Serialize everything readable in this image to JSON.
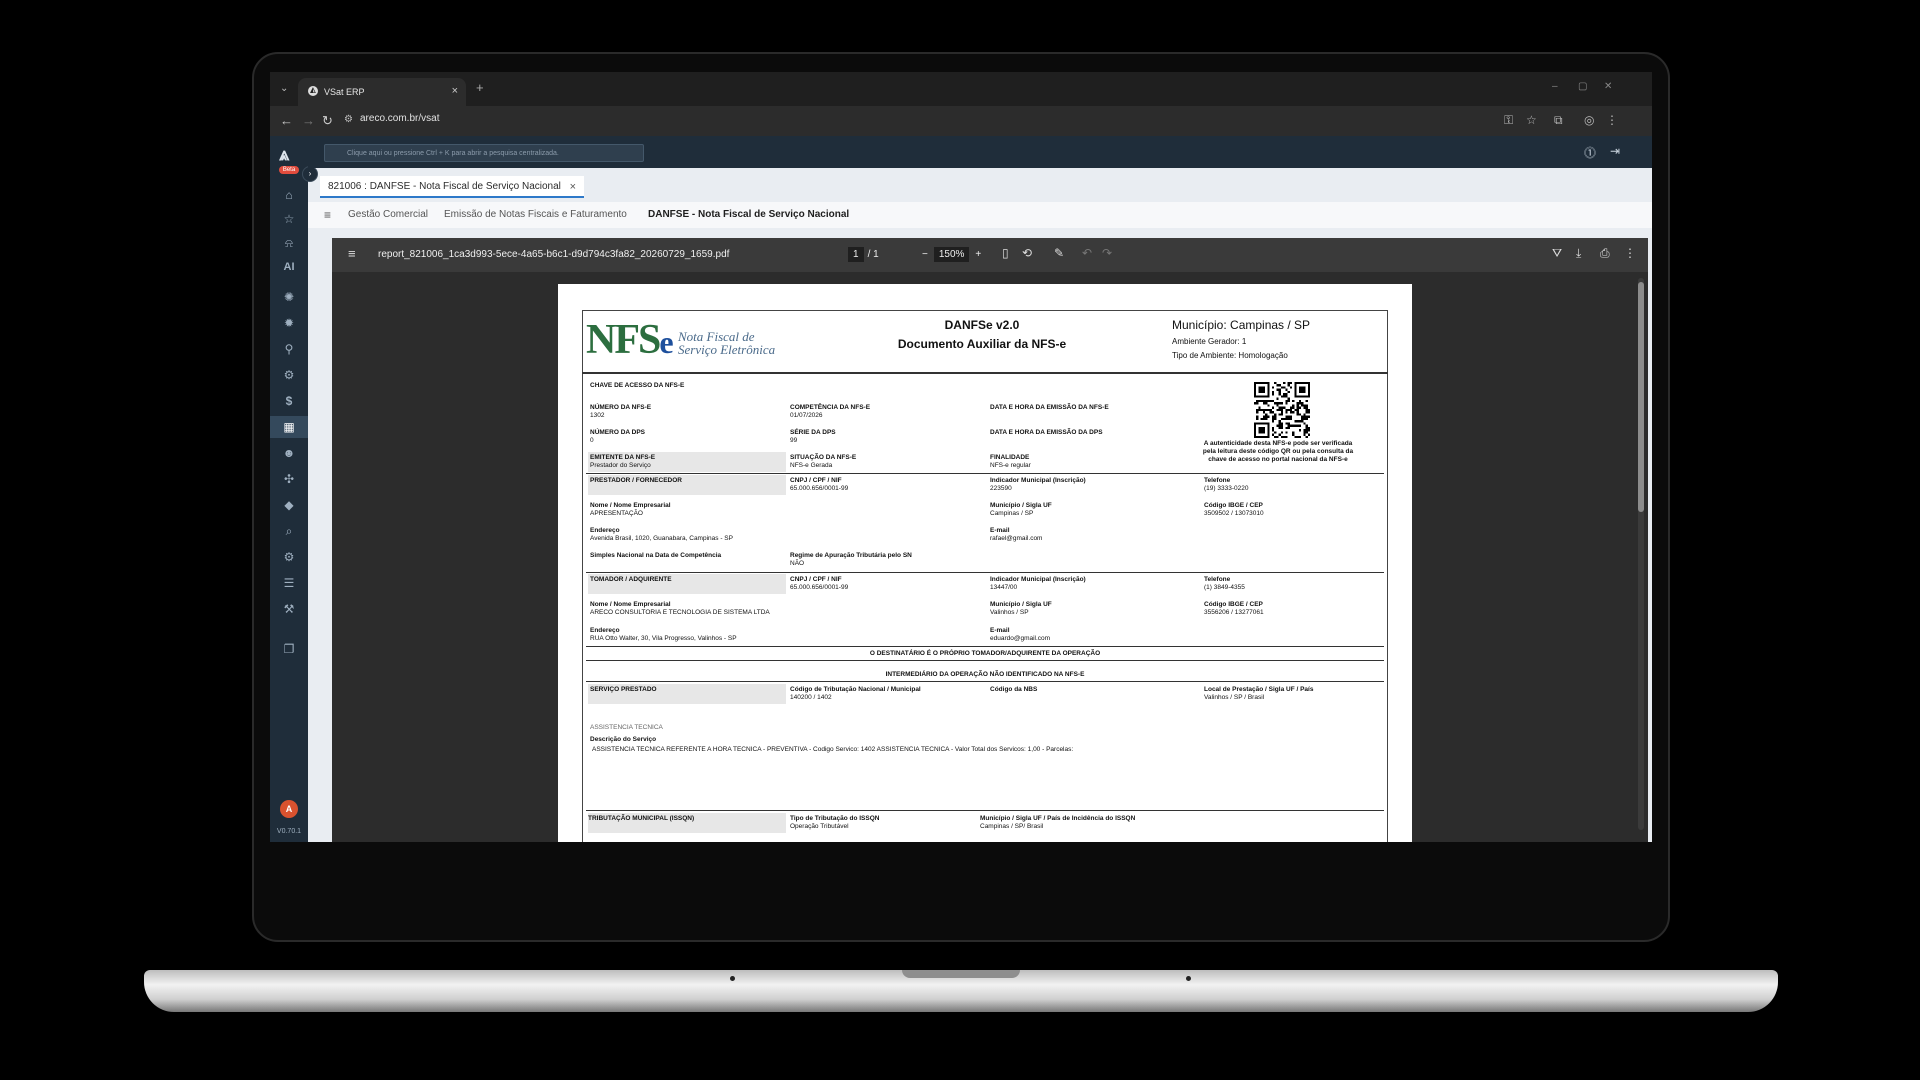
{
  "browser": {
    "tab_title": "VSat ERP",
    "url": "areco.com.br/vsat"
  },
  "app": {
    "beta": "Beta",
    "search_placeholder": "Clique aqui ou pressione Ctrl + K para abrir a pesquisa centralizada.",
    "sidebar_ai": "AI",
    "avatar_letter": "A",
    "version": "V0.70.1",
    "doc_tab": "821006 : DANFSE - Nota Fiscal de Serviço Nacional",
    "breadcrumb": [
      "Gestão Comercial",
      "Emissão de Notas Fiscais e Faturamento",
      "DANFSE - Nota Fiscal de Serviço Nacional"
    ]
  },
  "pdf": {
    "filename": "report_821006_1ca3d993-5ece-4a65-b6c1-d9d794c3fa82_20260729_1659.pdf",
    "page_current": "1",
    "page_sep": "/",
    "page_total": "1",
    "zoom": "150%"
  },
  "doc": {
    "logo_text": "NFS",
    "logo_e": "e",
    "logo_sub1": "Nota Fiscal de",
    "logo_sub2": "Serviço Eletrônica",
    "title": "DANFSe v2.0",
    "subtitle": "Documento Auxiliar da NFS-e",
    "municipio": "Município:  Campinas / SP",
    "ambiente": "Ambiente Gerador: 1",
    "tipo_ambiente": "Tipo de Ambiente:  Homologação",
    "chave_label": "CHAVE DE ACESSO DA NFS-E",
    "numero_label": "NÚMERO DA NFS-E",
    "numero": "1302",
    "competencia_label": "COMPETÊNCIA DA NFS-E",
    "competencia": "01/07/2026",
    "emissao_nfse_label": "DATA E HORA DA EMISSÃO DA NFS-E",
    "numero_dps_label": "NÚMERO DA DPS",
    "numero_dps": "0",
    "serie_dps_label": "SÉRIE DA DPS",
    "serie_dps": "99",
    "emissao_dps_label": "DATA E HORA DA EMISSÃO DA DPS",
    "emitente_label": "EMITENTE DA NFS-E",
    "emitente": "Prestador do Serviço",
    "situacao_label": "SITUAÇÃO DA NFS-E",
    "situacao": "NFS-e Gerada",
    "finalidade_label": "FINALIDADE",
    "finalidade": "NFS-e regular",
    "qr_note": "A autenticidade desta NFS-e pode ser verificada pela leitura deste código QR ou pela consulta da chave de acesso no portal nacional da NFS-e",
    "prestador_label": "PRESTADOR / FORNECEDOR",
    "p_cnpj_label": "CNPJ / CPF / NIF",
    "p_cnpj": "65.000.656/0001-99",
    "p_im_label": "Indicador Municipal (Inscrição)",
    "p_im": "223590",
    "p_tel_label": "Telefone",
    "p_tel": "(19) 3333-0220",
    "p_nome_label": "Nome / Nome Empresarial",
    "p_nome": "APRESENTAÇÃO",
    "p_mun_label": "Município / Sigla UF",
    "p_mun": "Campinas / SP",
    "p_ibge_label": "Código IBGE / CEP",
    "p_ibge": "3509502 / 13073010",
    "p_end_label": "Endereço",
    "p_end": "Avenida Brasil, 1020, Guanabara, Campinas - SP",
    "p_email_label": "E-mail",
    "p_email": "rafael@gmail.com",
    "p_simples_label": "Simples Nacional na Data de Competência",
    "p_regime_label": "Regime de Apuração Tributária pelo SN",
    "p_regime": "NÃO",
    "tomador_label": "TOMADOR / ADQUIRENTE",
    "t_cnpj_label": "CNPJ / CPF / NIF",
    "t_cnpj": "65.000.656/0001-99",
    "t_im_label": "Indicador Municipal (Inscrição)",
    "t_im": "13447/00",
    "t_tel_label": "Telefone",
    "t_tel": "(1) 3849-4355",
    "t_nome_label": "Nome / Nome Empresarial",
    "t_nome": "ARECO CONSULTORIA E TECNOLOGIA DE SISTEMA LTDA",
    "t_mun_label": "Município / Sigla UF",
    "t_mun": "Valinhos / SP",
    "t_ibge_label": "Código IBGE / CEP",
    "t_ibge": "3556206 / 13277061",
    "t_end_label": "Endereço",
    "t_end": "RUA Otto Walter, 30, Vila Progresso, Valinhos - SP",
    "t_email_label": "E-mail",
    "t_email": "eduardo@gmail.com",
    "destinatario": "O DESTINATÁRIO É O PRÓPRIO TOMADOR/ADQUIRENTE DA OPERAÇÃO",
    "intermediario": "INTERMEDIÁRIO DA OPERAÇÃO NÃO IDENTIFICADO NA NFS-E",
    "servico_label": "SERVIÇO PRESTADO",
    "s_cod_label": "Código de Tributação Nacional / Municipal",
    "s_cod": "140200 / 1402",
    "s_nbs_label": "Código da NBS",
    "s_local_label": "Local de Prestação / Sigla UF / País",
    "s_local": "Valinhos / SP / Brasil",
    "s_nome": "ASSISTENCIA TECNICA",
    "s_desc_label": "Descrição do Serviço",
    "s_desc": "ASSISTENCIA TECNICA REFERENTE A HORA TECNICA - PREVENTIVA - Codigo Servico: 1402 ASSISTENCIA TECNICA - Valor Total dos Servicos: 1,00 - Parcelas:",
    "trib_label": "TRIBUTAÇÃO MUNICIPAL (ISSQN)",
    "trib_tipo_label": "Tipo de Tributação do ISSQN",
    "trib_tipo": "Operação Tributável",
    "trib_mun_label": "Município / Sigla UF / País de Incidência do ISSQN",
    "trib_mun": "Campinas / SP/ Brasil"
  }
}
